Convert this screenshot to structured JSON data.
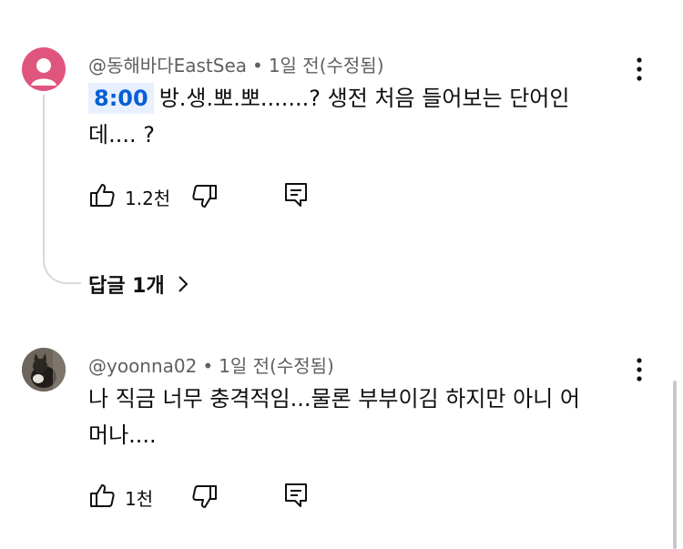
{
  "comments": [
    {
      "author": "@동해바다EastSea",
      "time": "1일 전(수정됨)",
      "timestamp_link": "8:00",
      "text_line1": "방.생.뽀.뽀.......? 생전 처음 들어보는 단어인",
      "text_line2": "데.... ?",
      "likes": "1.2천",
      "avatar_color": "#e0557e",
      "replies_label": "답글 1개"
    },
    {
      "author": "@yoonna02",
      "time": "1일 전(수정됨)",
      "text_line1": "나 직금 너무 충격적임...물론 부부이김 하지만 아니 어",
      "text_line2": "머나....",
      "likes": "1천"
    }
  ],
  "separator": "•",
  "icons": {
    "like": "thumb-up-icon",
    "dislike": "thumb-down-icon",
    "reply": "reply-icon",
    "more": "more-vertical-icon",
    "chevron": "chevron-right-icon"
  }
}
